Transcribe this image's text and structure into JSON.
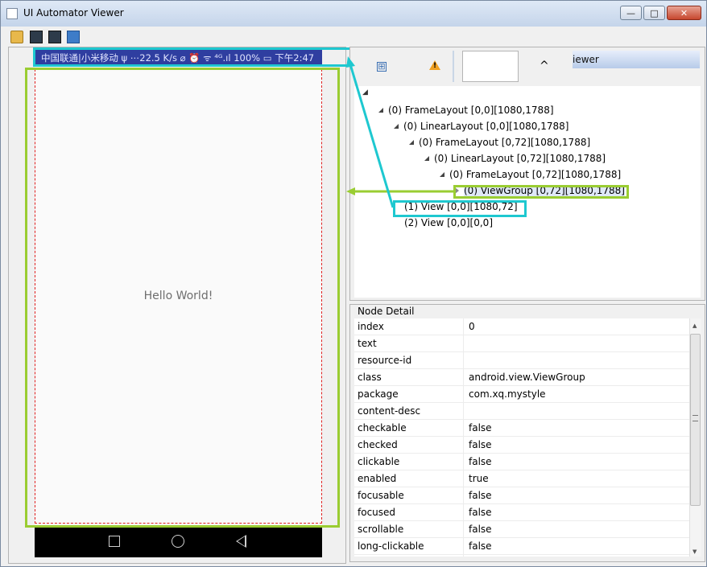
{
  "window": {
    "title": "UI Automator Viewer",
    "minimize": "—",
    "maximize": "□",
    "close": "✕"
  },
  "toolbar": {
    "items": [
      "open-icon",
      "device-screenshot-icon",
      "device-screenshot-compressed-icon",
      "save-icon"
    ]
  },
  "phone": {
    "status_text": "中国联通|小米移动 ψ ⋯22.5 K/s ⌀ ⏰ ᯤ ⁴ᴳ.ıl 100% ▭ 下午2:47",
    "hello_text": "Hello World!"
  },
  "hierarchy_toolbar": {
    "expand_icon": "⊞",
    "warning_mark": "!",
    "up_arrow": "^",
    "tab_label": "iewer"
  },
  "tree": {
    "root_marker": "◢",
    "rows": [
      {
        "label": "(0) FrameLayout [0,0][1080,1788]"
      },
      {
        "label": "(0) LinearLayout [0,0][1080,1788]"
      },
      {
        "label": "(0) FrameLayout [0,72][1080,1788]"
      },
      {
        "label": "(0) LinearLayout [0,72][1080,1788]"
      },
      {
        "label": "(0) FrameLayout [0,72][1080,1788]"
      },
      {
        "label": "(0) ViewGroup [0,72][1080,1788]"
      },
      {
        "label": "(1) View [0,0][1080,72]"
      },
      {
        "label": "(2) View [0,0][0,0]"
      }
    ]
  },
  "node_detail": {
    "title": "Node Detail",
    "rows": [
      {
        "key": "index",
        "value": "0"
      },
      {
        "key": "text",
        "value": ""
      },
      {
        "key": "resource-id",
        "value": ""
      },
      {
        "key": "class",
        "value": "android.view.ViewGroup"
      },
      {
        "key": "package",
        "value": "com.xq.mystyle"
      },
      {
        "key": "content-desc",
        "value": ""
      },
      {
        "key": "checkable",
        "value": "false"
      },
      {
        "key": "checked",
        "value": "false"
      },
      {
        "key": "clickable",
        "value": "false"
      },
      {
        "key": "enabled",
        "value": "true"
      },
      {
        "key": "focusable",
        "value": "false"
      },
      {
        "key": "focused",
        "value": "false"
      },
      {
        "key": "scrollable",
        "value": "false"
      },
      {
        "key": "long-clickable",
        "value": "false"
      }
    ]
  },
  "colors": {
    "annotation_green": "#9acd32",
    "annotation_cyan": "#1ec8d0",
    "selection_red": "#e02020",
    "phone_statusbar": "#2f3ea0"
  }
}
